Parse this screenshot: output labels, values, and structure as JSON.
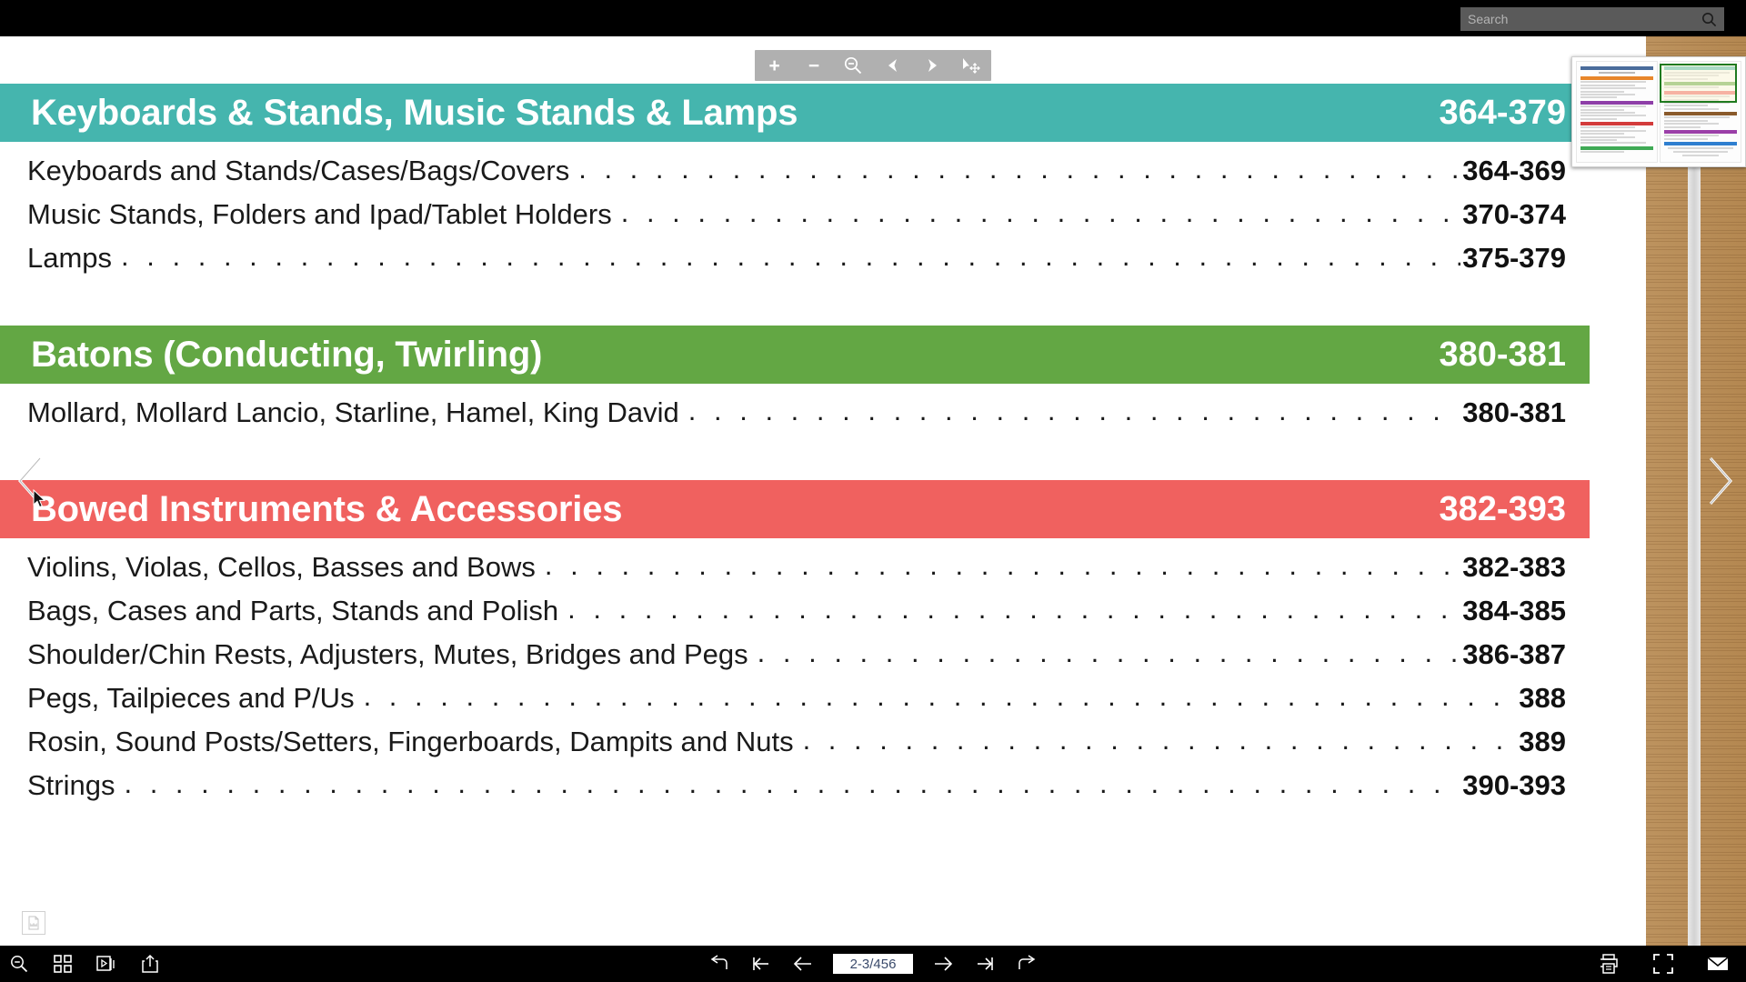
{
  "window": {
    "title": "Catalog Viewer"
  },
  "search": {
    "placeholder": "Search",
    "value": "",
    "icon": "search-icon"
  },
  "zoom_toolbar": {
    "buttons": [
      {
        "name": "zoom-in-button",
        "label": "+",
        "icon": "plus-icon"
      },
      {
        "name": "zoom-out-button",
        "label": "−",
        "icon": "minus-icon"
      },
      {
        "name": "magnifier-minus-button",
        "label": "",
        "icon": "magnifier-minus-icon"
      },
      {
        "name": "pan-left-button",
        "label": "",
        "icon": "arrow-left-icon"
      },
      {
        "name": "pan-right-button",
        "label": "",
        "icon": "arrow-right-icon"
      },
      {
        "name": "select-move-button",
        "label": "",
        "icon": "cursor-move-icon"
      }
    ]
  },
  "thumbnail": {
    "label": "page-thumbnail-preview",
    "selection_color": "#1f7a1f"
  },
  "document": {
    "sections": [
      {
        "title": "Keyboards & Stands, Music Stands & Lamps",
        "pages": "364-379",
        "color": "#45B5AE",
        "entries": [
          {
            "label": "Keyboards and Stands/Cases/Bags/Covers",
            "pages": "364-369"
          },
          {
            "label": "Music Stands, Folders and Ipad/Tablet Holders",
            "pages": "370-374"
          },
          {
            "label": "Lamps",
            "pages": "375-379"
          }
        ]
      },
      {
        "title": "Batons (Conducting, Twirling)",
        "pages": "380-381",
        "color": "#63A744",
        "entries": [
          {
            "label": "Mollard, Mollard Lancio, Starline, Hamel, King David",
            "pages": "380-381"
          }
        ]
      },
      {
        "title": "Bowed Instruments & Accessories",
        "pages": "382-393",
        "color": "#F0615F",
        "entries": [
          {
            "label": "Violins, Violas, Cellos, Basses and Bows",
            "pages": "382-383"
          },
          {
            "label": "Bags, Cases and Parts, Stands and Polish",
            "pages": "384-385"
          },
          {
            "label": "Shoulder/Chin Rests, Adjusters, Mutes, Bridges and Pegs",
            "pages": "386-387"
          },
          {
            "label": "Pegs, Tailpieces and P/Us",
            "pages": "388"
          },
          {
            "label": "Rosin, Sound Posts/Setters, Fingerboards, Dampits and Nuts",
            "pages": "389"
          },
          {
            "label": "Strings",
            "pages": "390-393"
          }
        ]
      }
    ],
    "dots": ". . . . . . . . . . . . . . . . . . . . . . . . . . . . . . . . . . . . . . . . . . . . . . . . . . . . . . . . . . . . . . . . . . . . . . . . . . . . . . . . . . . . . . . . . . . . . . . . . . . ."
  },
  "page_flip": {
    "previous_label": "previous-page",
    "next_label": "next-page"
  },
  "bottom_bar": {
    "left_buttons": [
      {
        "name": "search-toggle-button",
        "icon": "magnifier-minus-icon"
      },
      {
        "name": "thumbnails-grid-button",
        "icon": "grid-icon"
      },
      {
        "name": "slideshow-button",
        "icon": "slideshow-icon"
      },
      {
        "name": "share-button",
        "icon": "share-icon"
      }
    ],
    "nav_buttons_left": [
      {
        "name": "back-button",
        "icon": "arrow-back-curved-icon"
      },
      {
        "name": "first-page-button",
        "icon": "first-page-icon"
      },
      {
        "name": "previous-page-button",
        "icon": "arrow-left-icon"
      }
    ],
    "nav_buttons_right": [
      {
        "name": "next-page-button",
        "icon": "arrow-right-icon"
      },
      {
        "name": "last-page-button",
        "icon": "last-page-icon"
      },
      {
        "name": "forward-button",
        "icon": "arrow-forward-curved-icon"
      }
    ],
    "page_indicator": "2-3/456",
    "right_buttons": [
      {
        "name": "print-button",
        "icon": "print-icon"
      },
      {
        "name": "fullscreen-button",
        "icon": "fullscreen-icon"
      },
      {
        "name": "email-button",
        "icon": "email-icon"
      }
    ]
  }
}
